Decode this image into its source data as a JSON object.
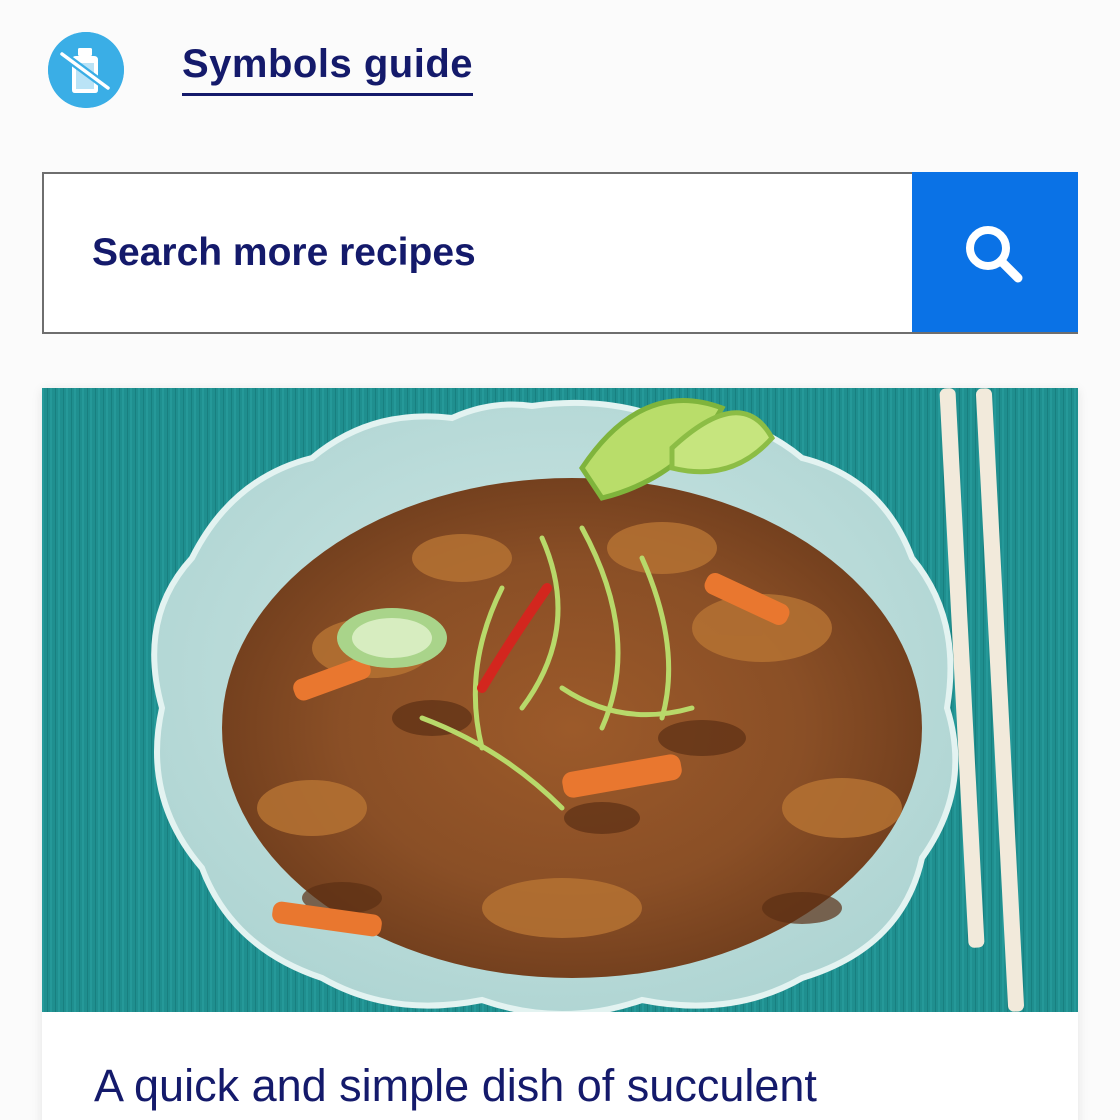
{
  "header": {
    "symbols_link_label": "Symbols guide",
    "symbol_icon": "no-alcohol-icon"
  },
  "search": {
    "placeholder": "Search more recipes",
    "button_icon": "search-icon"
  },
  "recipe_card": {
    "description": "A quick and simple dish of succulent"
  },
  "colors": {
    "brand_navy": "#141a6b",
    "accent_blue": "#0a72e6",
    "icon_blue": "#3aaee6",
    "table_teal": "#1f8f8f"
  }
}
